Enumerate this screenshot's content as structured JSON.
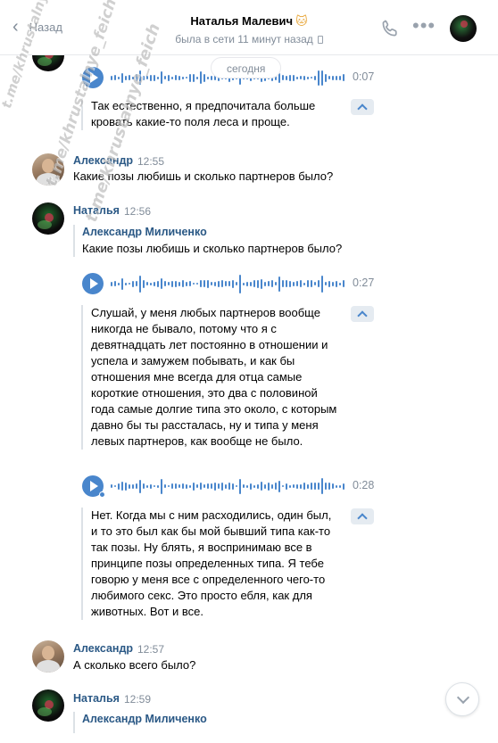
{
  "header": {
    "back_label": "Назад",
    "title": "Наталья Малевич",
    "title_emoji": "🐱",
    "status": "была в сети 11 минут назад"
  },
  "date_divider": "сегодня",
  "messages": [
    {
      "audio": {
        "duration": "0:07"
      },
      "transcript": [
        "Так естественно, я предпочитала больше",
        "кровать какие-то поля леса и проще."
      ]
    },
    {
      "author": "Александр",
      "time": "12:55",
      "text": "Какие позы любишь и сколько партнеров было?"
    },
    {
      "author": "Наталья",
      "time": "12:56",
      "reply": {
        "name": "Александр Миличенко",
        "text": "Какие позы любишь и сколько партнеров было?"
      },
      "audio": {
        "duration": "0:27"
      },
      "transcript": [
        "Слушай, у меня любых партнеров вообще",
        "никогда не бывало, потому что я с",
        "девятнадцать лет постоянно в отношении и",
        "успела и замужем побывать, и как бы",
        "отношения мне всегда для отца самые",
        "короткие отношения, это два с половиной",
        "года самые долгие типа это около, с которым",
        "давно бы ты рассталась, ну и типа у меня",
        "левых партнеров, как вообще не было."
      ],
      "audio2": {
        "duration": "0:28"
      },
      "transcript2": [
        "Нет. Когда мы с ним расходились, один был,",
        "и то это был как бы мой бывший типа как-то",
        "так позы. Ну блять, я воспринимаю все в",
        "принципе позы определенных типа. Я тебе",
        "говорю у меня все с определенного чего-то",
        "любимого секс. Это просто ебля, как для",
        "животных. Вот и все."
      ]
    },
    {
      "author": "Александр",
      "time": "12:57",
      "text": "А сколько всего было?"
    },
    {
      "author": "Наталья",
      "time": "12:59",
      "reply": {
        "name": "Александр Миличенко"
      }
    }
  ],
  "watermark": [
    "t.me/khrustalnye_feich",
    "t.me/khrustalnye_feich",
    "t.me/khrustalnye_feich"
  ],
  "colors": {
    "accent": "#4986cc",
    "link": "#2a5885",
    "muted": "#818c99"
  },
  "icons": {
    "call": "phone-icon",
    "more": "more-icon",
    "play": "play-icon",
    "collapse": "chevron-up-icon",
    "scroll": "chevron-down-icon"
  }
}
